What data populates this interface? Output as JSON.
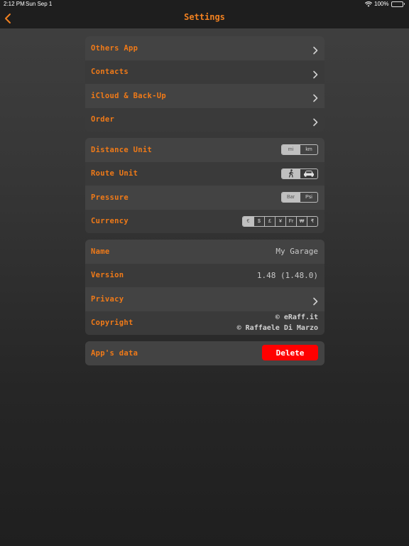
{
  "status_bar": {
    "time": "2:12 PM",
    "date": "Sun Sep 1",
    "battery": "100%"
  },
  "nav": {
    "title": "Settings",
    "back_icon": "chevron-left-icon"
  },
  "colors": {
    "accent": "#f07a18",
    "delete": "#ff0000"
  },
  "group1": {
    "items": [
      {
        "label": "Others App"
      },
      {
        "label": "Contacts"
      },
      {
        "label": "iCloud & Back-Up"
      },
      {
        "label": "Order"
      }
    ]
  },
  "group2": {
    "distance": {
      "label": "Distance Unit",
      "options": [
        "mi",
        "km"
      ],
      "selected": "mi"
    },
    "route": {
      "label": "Route Unit",
      "options": [
        "walking-icon",
        "car-icon"
      ],
      "selected": "walking-icon"
    },
    "pressure": {
      "label": "Pressure",
      "options": [
        "Bar",
        "Psi"
      ],
      "selected": "Bar"
    },
    "currency": {
      "label": "Currency",
      "options": [
        "€",
        "$",
        "£",
        "¥",
        "Fr",
        "₩",
        "₹"
      ],
      "selected": "€"
    }
  },
  "group3": {
    "name": {
      "label": "Name",
      "value": "My Garage"
    },
    "version": {
      "label": "Version",
      "value": "1.48 (1.48.0)"
    },
    "privacy": {
      "label": "Privacy"
    },
    "copyright": {
      "label": "Copyright",
      "line1": "© eRaff.it",
      "line2": "© Raffaele Di Marzo"
    }
  },
  "group4": {
    "data": {
      "label": "App's data",
      "button": "Delete"
    }
  }
}
